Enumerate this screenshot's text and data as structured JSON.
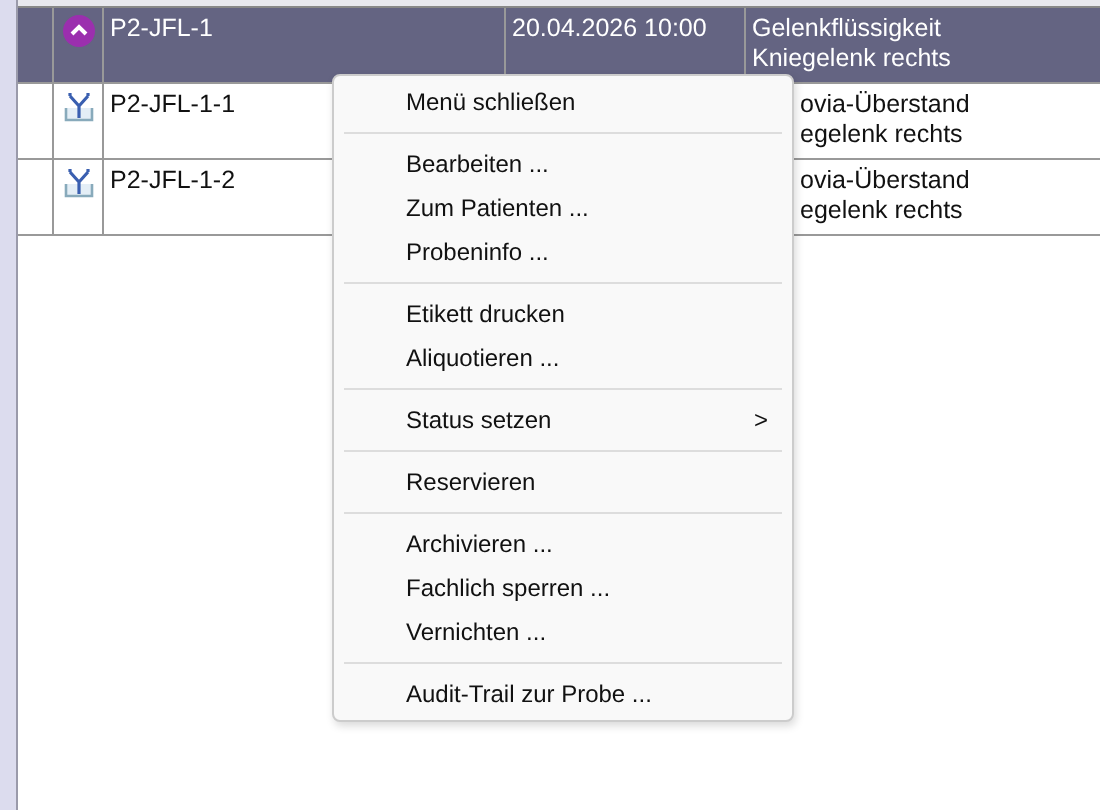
{
  "table": {
    "rows": [
      {
        "selected": true,
        "kind": "parent",
        "id": "P2-JFL-1",
        "date": "20.04.2026 10:00",
        "description": [
          "Gelenkflüssigkeit",
          "Kniegelenk rechts"
        ]
      },
      {
        "selected": false,
        "kind": "aliquot",
        "id": "P2-JFL-1-1",
        "description": [
          "ovia-Überstand",
          "egelenk rechts"
        ]
      },
      {
        "selected": false,
        "kind": "aliquot",
        "id": "P2-JFL-1-2",
        "description": [
          "ovia-Überstand",
          "egelenk rechts"
        ]
      }
    ]
  },
  "context_menu": {
    "items": [
      {
        "kind": "item",
        "label": "Menü schließen"
      },
      {
        "kind": "separator"
      },
      {
        "kind": "item",
        "label": "Bearbeiten ..."
      },
      {
        "kind": "item",
        "label": "Zum Patienten ..."
      },
      {
        "kind": "item",
        "label": "Probeninfo ..."
      },
      {
        "kind": "separator"
      },
      {
        "kind": "item",
        "label": "Etikett drucken"
      },
      {
        "kind": "item",
        "label": "Aliquotieren ..."
      },
      {
        "kind": "separator"
      },
      {
        "kind": "submenu",
        "label": "Status setzen",
        "arrow": ">"
      },
      {
        "kind": "separator"
      },
      {
        "kind": "item",
        "label": "Reservieren"
      },
      {
        "kind": "separator"
      },
      {
        "kind": "item",
        "label": "Archivieren ..."
      },
      {
        "kind": "item",
        "label": "Fachlich sperren ..."
      },
      {
        "kind": "item",
        "label": "Vernichten ..."
      },
      {
        "kind": "separator"
      },
      {
        "kind": "item",
        "label": "Audit-Trail zur Probe ..."
      }
    ]
  }
}
